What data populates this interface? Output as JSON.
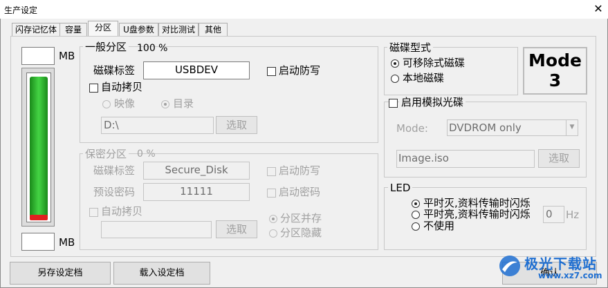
{
  "window": {
    "title": "生产设定",
    "close_glyph": "✕"
  },
  "tabs": [
    {
      "label": "闪存记忆体"
    },
    {
      "label": "容量"
    },
    {
      "label": "分区"
    },
    {
      "label": "U盘参数"
    },
    {
      "label": "对比测试"
    },
    {
      "label": "其他"
    }
  ],
  "capacity": {
    "top_unit": "MB",
    "bottom_unit": "MB",
    "top_value": "",
    "bottom_value": ""
  },
  "general_partition": {
    "title": "一般分区",
    "percent": "100 %",
    "disk_label_caption": "磁碟标签",
    "disk_label_value": "USBDEV",
    "write_protect": "启动防写",
    "auto_copy": "自动拷贝",
    "mode_image": "映像",
    "mode_directory": "目录",
    "path_value": "D:\\",
    "select_button": "选取"
  },
  "secure_partition": {
    "title": "保密分区",
    "percent": "0 %",
    "disk_label_caption": "磁碟标签",
    "disk_label_value": "Secure_Disk",
    "write_protect": "启动防写",
    "preset_password_caption": "预设密码",
    "preset_password_value": "11111",
    "enable_password": "启动密码",
    "auto_copy": "自动拷贝",
    "path_value": "",
    "select_button": "选取",
    "coexist": "分区并存",
    "hidden": "分区隐藏"
  },
  "disk_type": {
    "title": "磁碟型式",
    "removable": "可移除式磁碟",
    "local": "本地磁碟"
  },
  "mode_badge": {
    "line1": "Mode",
    "line2": "3"
  },
  "cdrom": {
    "title": "启用模拟光碟",
    "mode_caption": "Mode:",
    "mode_value": "DVDROM only",
    "image_value": "Image.iso",
    "select_button": "选取"
  },
  "led": {
    "title": "LED",
    "option1": "平时灭,资料传输时闪烁",
    "option2": "平时亮,资料传输时闪烁",
    "option3": "不使用",
    "hz_value": "0",
    "hz_unit": "Hz"
  },
  "footer": {
    "save_as": "另存设定档",
    "load": "载入设定档",
    "confirm": "确认"
  },
  "watermark": {
    "brand": "极光下载站",
    "url": "www.xz7.com"
  },
  "colors": {
    "gauge_green": "#44d444",
    "gauge_red": "#e02020",
    "watermark_blue": "#1f6fd1"
  }
}
